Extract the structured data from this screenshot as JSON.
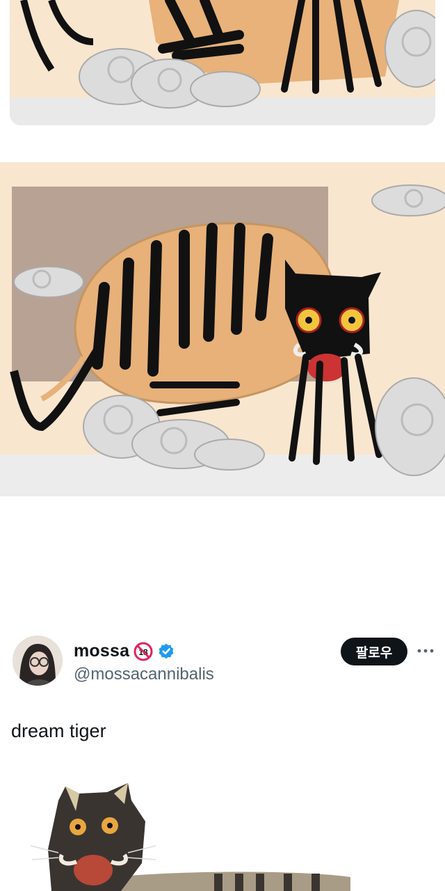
{
  "tweet": {
    "display_name": "mossa",
    "handle": "@mossacannibalis",
    "follow_label": "팔로우",
    "text": "dream tiger",
    "badge_18_label": "18"
  },
  "icons": {
    "age_badge": "adult-content-18-icon",
    "verified": "verified-badge-icon",
    "more": "more-options-icon"
  },
  "colors": {
    "verified_blue": "#1d9bf0",
    "follow_bg": "#0f1419",
    "handle_gray": "#536471",
    "badge_red": "#e0245e"
  }
}
